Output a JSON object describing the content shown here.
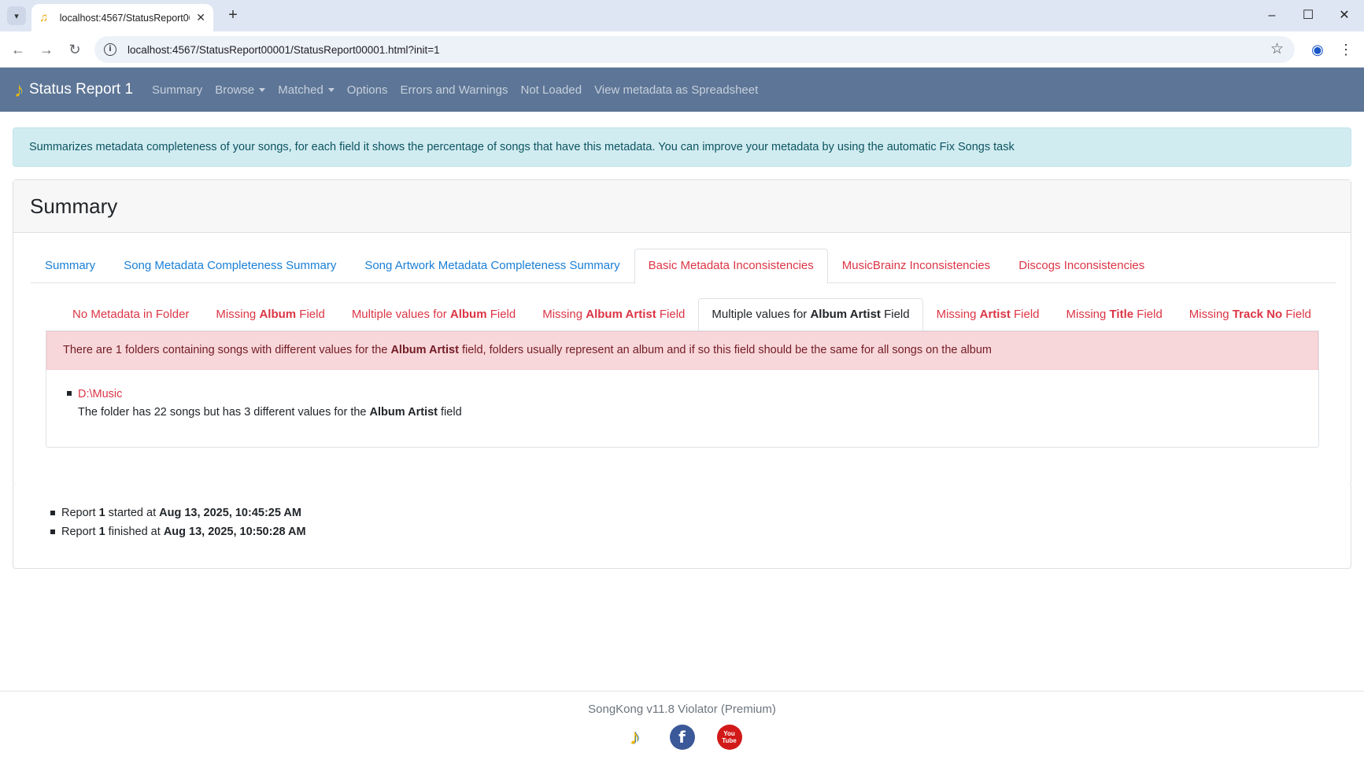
{
  "browser": {
    "tab_title": "localhost:4567/StatusReport00001/StatusReport00001.html?init=1",
    "url": "localhost:4567/StatusReport00001/StatusReport00001.html?init=1",
    "icons": {
      "tab_menu": "chevron-down-icon",
      "favicon": "music-note-icon",
      "tab_close": "close-icon",
      "new_tab": "plus-icon",
      "minimize": "minimize-icon",
      "maximize": "maximize-icon",
      "close_window": "close-icon",
      "back": "arrow-left-icon",
      "forward": "arrow-right-icon",
      "reload": "reload-icon",
      "site_info": "info-icon",
      "bookmark": "star-icon",
      "profile": "profile-icon",
      "menu": "kebab-icon"
    }
  },
  "navbar": {
    "brand": "Status Report 1",
    "links": {
      "summary": "Summary",
      "browse": "Browse",
      "matched": "Matched",
      "options": "Options",
      "errors": "Errors and Warnings",
      "not_loaded": "Not Loaded",
      "spreadsheet": "View metadata as Spreadsheet"
    }
  },
  "info_alert": "Summarizes metadata completeness of your songs, for each field it shows the percentage of songs that have this metadata. You can improve your metadata by using the automatic Fix Songs task",
  "card": {
    "header": "Summary",
    "tabs": {
      "summary": "Summary",
      "song_metadata": "Song Metadata Completeness Summary",
      "artwork_metadata": "Song Artwork Metadata Completeness Summary",
      "basic_inconsistencies": "Basic Metadata Inconsistencies",
      "musicbrainz": "MusicBrainz Inconsistencies",
      "discogs": "Discogs Inconsistencies"
    },
    "subtabs": {
      "no_metadata": "No Metadata in Folder",
      "missing": "Missing",
      "multiple": "Multiple values for",
      "field": "Field",
      "album": "Album",
      "album_artist": "Album Artist",
      "artist": "Artist",
      "title": "Title",
      "track_no": "Track No"
    },
    "danger_alert": {
      "prefix": "There are 1 folders containing songs with different values for the",
      "field": "Album Artist",
      "suffix": "field, folders usually represent an album and if so this field should be the same for all songs on the album"
    },
    "folders": [
      {
        "path": "D:\\Music",
        "desc_prefix": "The folder has 22 songs but has 3 different values for the",
        "desc_field": "Album Artist",
        "desc_suffix": "field"
      }
    ]
  },
  "report": {
    "word": "Report",
    "number": "1",
    "started_label": "started at",
    "started_at": "Aug 13, 2025, 10:45:25 AM",
    "finished_label": "finished at",
    "finished_at": "Aug 13, 2025, 10:50:28 AM"
  },
  "footer": {
    "text": "SongKong v11.8 Violator (Premium)",
    "youtube_top": "You",
    "youtube_bottom": "Tube"
  }
}
